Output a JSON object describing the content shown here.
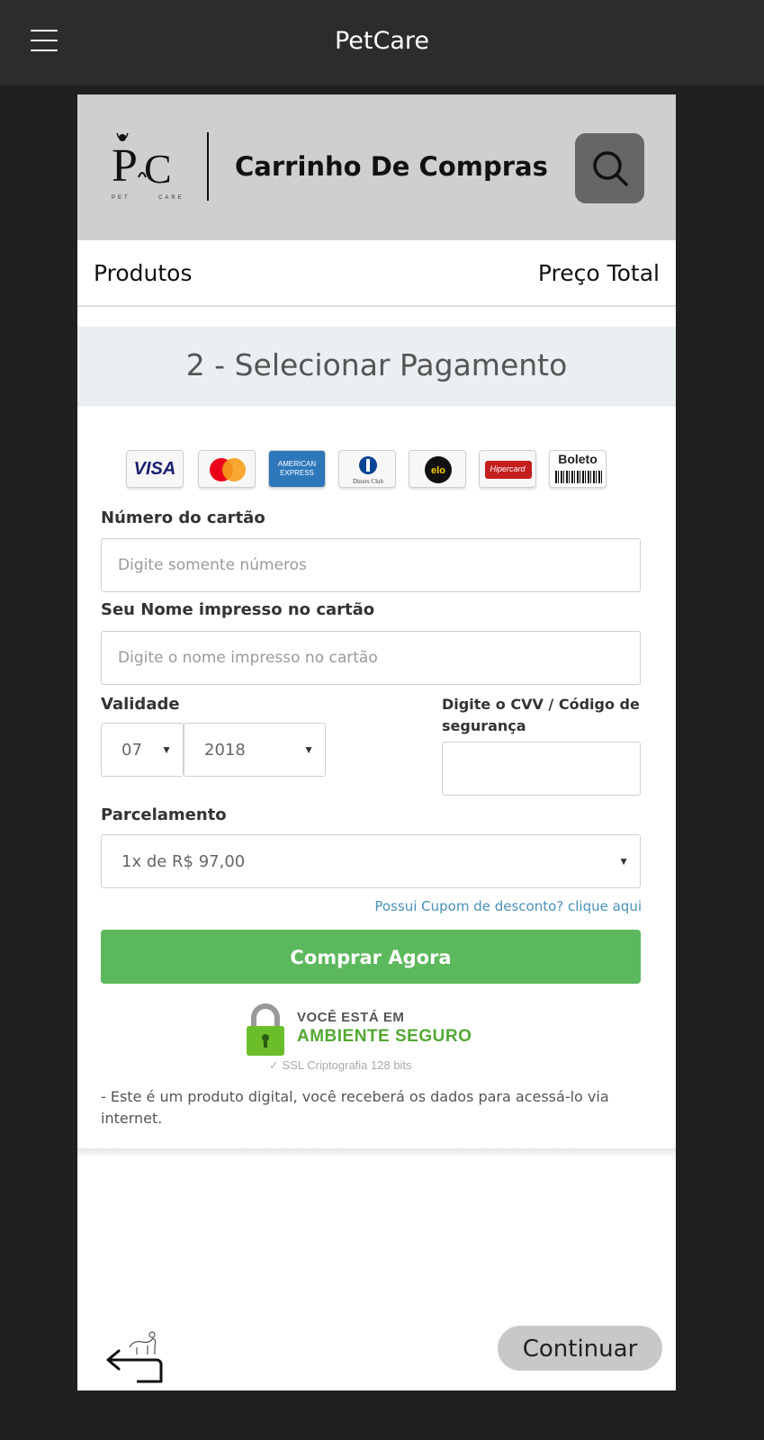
{
  "app": {
    "title": "PetCare"
  },
  "header": {
    "logo_text": "PC",
    "logo_sub": "PET CARE",
    "title": "Carrinho De Compras"
  },
  "columns": {
    "products": "Produtos",
    "total_price": "Preço Total"
  },
  "payment": {
    "section_title": "2 - Selecionar Pagamento",
    "card_brands": [
      "VISA",
      "MasterCard",
      "American Express",
      "Diners Club",
      "elo",
      "Hipercard",
      "Boleto"
    ],
    "card_number": {
      "label": "Número do cartão",
      "placeholder": "Digite somente números"
    },
    "card_name": {
      "label": "Seu Nome impresso no cartão",
      "placeholder": "Digite o nome impresso no cartão"
    },
    "validity": {
      "label": "Validade",
      "month": "07",
      "year": "2018"
    },
    "cvv": {
      "label": "Digite o CVV / Código de segurança",
      "value": ""
    },
    "installments": {
      "label": "Parcelamento",
      "value": "1x de R$ 97,00"
    },
    "coupon_link": "Possui Cupom de desconto? clique aqui",
    "buy_button": "Comprar Agora",
    "secure": {
      "line1": "VOCÊ ESTÁ EM",
      "line2": "AMBIENTE SEGURO",
      "line3": "✓ SSL Criptografia 128 bits"
    },
    "note": "- Este é um produto digital, você receberá os dados para acessá-lo via internet."
  },
  "footer": {
    "continue_button": "Continuar"
  },
  "colors": {
    "topbar": "#2c2c2c",
    "header": "#cfcfcf",
    "buy_button": "#5cb85c",
    "secure_green": "#54a833",
    "link": "#4a90b8"
  }
}
